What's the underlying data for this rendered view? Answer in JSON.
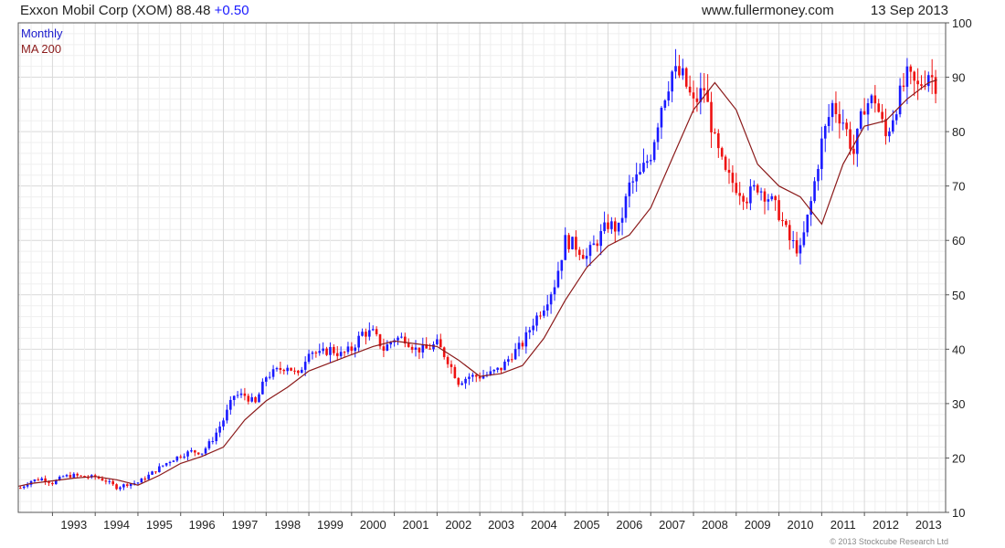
{
  "header": {
    "title": "Exxon Mobil Corp (XOM)",
    "price": "88.48",
    "change": "+0.50",
    "site": "www.fullermoney.com",
    "date": "13 Sep 2013"
  },
  "legend": {
    "series1": "Monthly",
    "series2": "MA 200"
  },
  "copyright": "© 2013 Stockcube Research Ltd",
  "colors": {
    "up": "#1a1aff",
    "down": "#ee1111",
    "ma": "#8b1a1a",
    "grid": "#d9d9d9",
    "frame": "#555555"
  },
  "chart_data": {
    "type": "line",
    "title": "Exxon Mobil Corp (XOM)",
    "xlabel": "",
    "ylabel": "",
    "ylim": [
      10,
      100
    ],
    "y_ticks": [
      10,
      20,
      30,
      40,
      50,
      60,
      70,
      80,
      90,
      100
    ],
    "x_range": [
      1992.2,
      2013.9
    ],
    "x_tick_labels": [
      "1993",
      "1994",
      "1995",
      "1996",
      "1997",
      "1998",
      "1999",
      "2000",
      "2001",
      "2002",
      "2003",
      "2004",
      "2005",
      "2006",
      "2007",
      "2008",
      "2009",
      "2010",
      "2011",
      "2012",
      "2013"
    ],
    "grid": true,
    "legend_position": "top-left",
    "series": [
      {
        "name": "Monthly",
        "style": "candlestick",
        "x": [
          1992.25,
          1992.5,
          1992.75,
          1993.0,
          1993.25,
          1993.5,
          1993.75,
          1994.0,
          1994.25,
          1994.5,
          1994.75,
          1995.0,
          1995.25,
          1995.5,
          1995.75,
          1996.0,
          1996.25,
          1996.5,
          1996.75,
          1997.0,
          1997.25,
          1997.5,
          1997.75,
          1998.0,
          1998.25,
          1998.5,
          1998.75,
          1999.0,
          1999.25,
          1999.5,
          1999.75,
          2000.0,
          2000.25,
          2000.5,
          2000.75,
          2001.0,
          2001.25,
          2001.5,
          2001.75,
          2002.0,
          2002.25,
          2002.5,
          2002.75,
          2003.0,
          2003.25,
          2003.5,
          2003.75,
          2004.0,
          2004.25,
          2004.5,
          2004.75,
          2005.0,
          2005.25,
          2005.5,
          2005.75,
          2006.0,
          2006.25,
          2006.5,
          2006.75,
          2007.0,
          2007.25,
          2007.5,
          2007.75,
          2008.0,
          2008.25,
          2008.5,
          2008.75,
          2009.0,
          2009.25,
          2009.5,
          2009.75,
          2010.0,
          2010.25,
          2010.5,
          2010.75,
          2011.0,
          2011.25,
          2011.5,
          2011.75,
          2012.0,
          2012.25,
          2012.5,
          2012.75,
          2013.0,
          2013.25,
          2013.5,
          2013.7
        ],
        "close": [
          14.5,
          15.8,
          16.2,
          15.4,
          16.6,
          16.8,
          16.5,
          16.5,
          15.8,
          14.6,
          15.2,
          15.5,
          16.8,
          18.2,
          19.5,
          20.5,
          21.2,
          21.0,
          23.5,
          27.0,
          31.5,
          31.5,
          30.0,
          35.0,
          36.0,
          37.0,
          35.0,
          40.0,
          39.0,
          40.0,
          39.0,
          40.0,
          43.0,
          43.0,
          40.0,
          42.0,
          42.0,
          40.0,
          40.0,
          41.0,
          38.0,
          34.0,
          35.0,
          35.0,
          35.5,
          36.5,
          39.0,
          41.0,
          45.0,
          48.0,
          52.0,
          60.0,
          59.0,
          57.0,
          60.0,
          63.0,
          62.0,
          70.0,
          72.0,
          76.0,
          85.0,
          91.0,
          90.0,
          85.0,
          88.0,
          78.0,
          72.0,
          70.0,
          68.0,
          70.0,
          68.0,
          65.0,
          60.0,
          58.0,
          67.0,
          78.0,
          85.0,
          82.0,
          76.0,
          85.0,
          86.0,
          79.0,
          85.0,
          90.0,
          88.0,
          91.0,
          88.5
        ]
      },
      {
        "name": "MA 200",
        "style": "line",
        "x": [
          1992.2,
          1992.5,
          1993.0,
          1993.5,
          1994.0,
          1994.5,
          1995.0,
          1995.5,
          1996.0,
          1996.5,
          1997.0,
          1997.5,
          1998.0,
          1998.5,
          1999.0,
          1999.5,
          2000.0,
          2000.5,
          2001.0,
          2001.5,
          2002.0,
          2002.5,
          2003.0,
          2003.5,
          2004.0,
          2004.5,
          2005.0,
          2005.5,
          2006.0,
          2006.5,
          2007.0,
          2007.5,
          2008.0,
          2008.5,
          2009.0,
          2009.5,
          2010.0,
          2010.5,
          2011.0,
          2011.5,
          2012.0,
          2012.5,
          2013.0,
          2013.5,
          2013.7
        ],
        "y": [
          14.8,
          15.3,
          15.8,
          16.3,
          16.6,
          16.0,
          15.0,
          16.8,
          19.0,
          20.3,
          22.0,
          27.0,
          30.5,
          33.0,
          36.0,
          37.5,
          39.0,
          40.5,
          41.5,
          41.0,
          40.5,
          38.0,
          35.0,
          35.5,
          37.0,
          42.0,
          49.0,
          55.0,
          59.0,
          61.0,
          66.0,
          75.0,
          84.0,
          89.0,
          84.0,
          74.0,
          70.0,
          68.0,
          63.0,
          74.0,
          81.0,
          82.0,
          86.0,
          89.0,
          89.5
        ]
      }
    ]
  }
}
